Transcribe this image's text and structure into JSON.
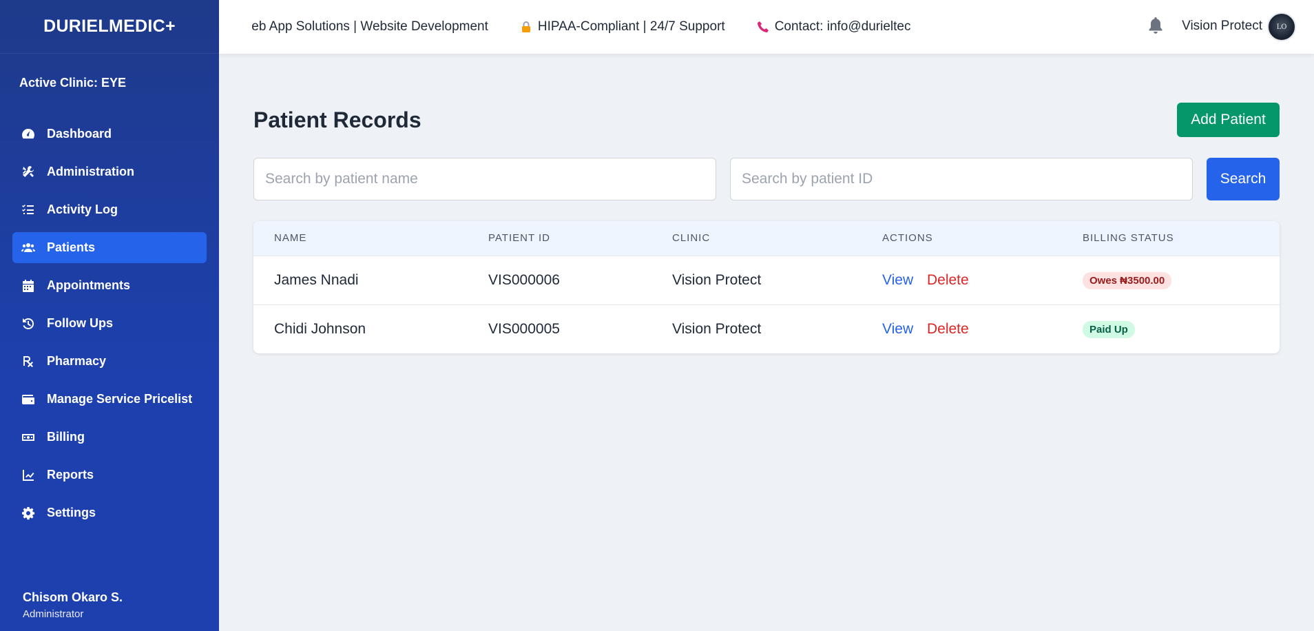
{
  "brand": "DURIELMEDIC+",
  "active_clinic": "Active Clinic: EYE",
  "nav": [
    {
      "label": "Dashboard",
      "icon": "gauge-icon"
    },
    {
      "label": "Administration",
      "icon": "tools-icon"
    },
    {
      "label": "Activity Log",
      "icon": "list-check-icon"
    },
    {
      "label": "Patients",
      "icon": "users-icon",
      "active": true
    },
    {
      "label": "Appointments",
      "icon": "calendar-icon"
    },
    {
      "label": "Follow Ups",
      "icon": "history-icon"
    },
    {
      "label": "Pharmacy",
      "icon": "prescription-icon"
    },
    {
      "label": "Manage Service Pricelist",
      "icon": "wallet-icon"
    },
    {
      "label": "Billing",
      "icon": "money-bill-icon"
    },
    {
      "label": "Reports",
      "icon": "chart-line-icon"
    },
    {
      "label": "Settings",
      "icon": "gear-icon"
    }
  ],
  "user": {
    "name": "Chisom Okaro S.",
    "role": "Administrator"
  },
  "ticker": [
    {
      "text": "/eb App Solutions | Website Development"
    },
    {
      "text": "HIPAA-Compliant | 24/7 Support",
      "icon": "lock-icon"
    },
    {
      "text": "Contact: info@durieltec",
      "icon": "phone-icon"
    }
  ],
  "account": {
    "name": "Vision Protect",
    "avatar_text": "LO"
  },
  "page": {
    "title": "Patient Records",
    "add_button": "Add Patient",
    "search_name_placeholder": "Search by patient name",
    "search_id_placeholder": "Search by patient ID",
    "search_button": "Search"
  },
  "table": {
    "headers": [
      "NAME",
      "PATIENT ID",
      "CLINIC",
      "ACTIONS",
      "BILLING STATUS"
    ],
    "rows": [
      {
        "name": "James Nnadi",
        "id": "VIS000006",
        "clinic": "Vision Protect",
        "view": "View",
        "delete": "Delete",
        "billing": "Owes ₦3500.00",
        "billing_type": "owes"
      },
      {
        "name": "Chidi Johnson",
        "id": "VIS000005",
        "clinic": "Vision Protect",
        "view": "View",
        "delete": "Delete",
        "billing": "Paid Up",
        "billing_type": "paid"
      }
    ]
  },
  "colors": {
    "sidebar": "#1e40af",
    "primary": "#2563eb",
    "success": "#059669",
    "danger": "#dc2626"
  }
}
